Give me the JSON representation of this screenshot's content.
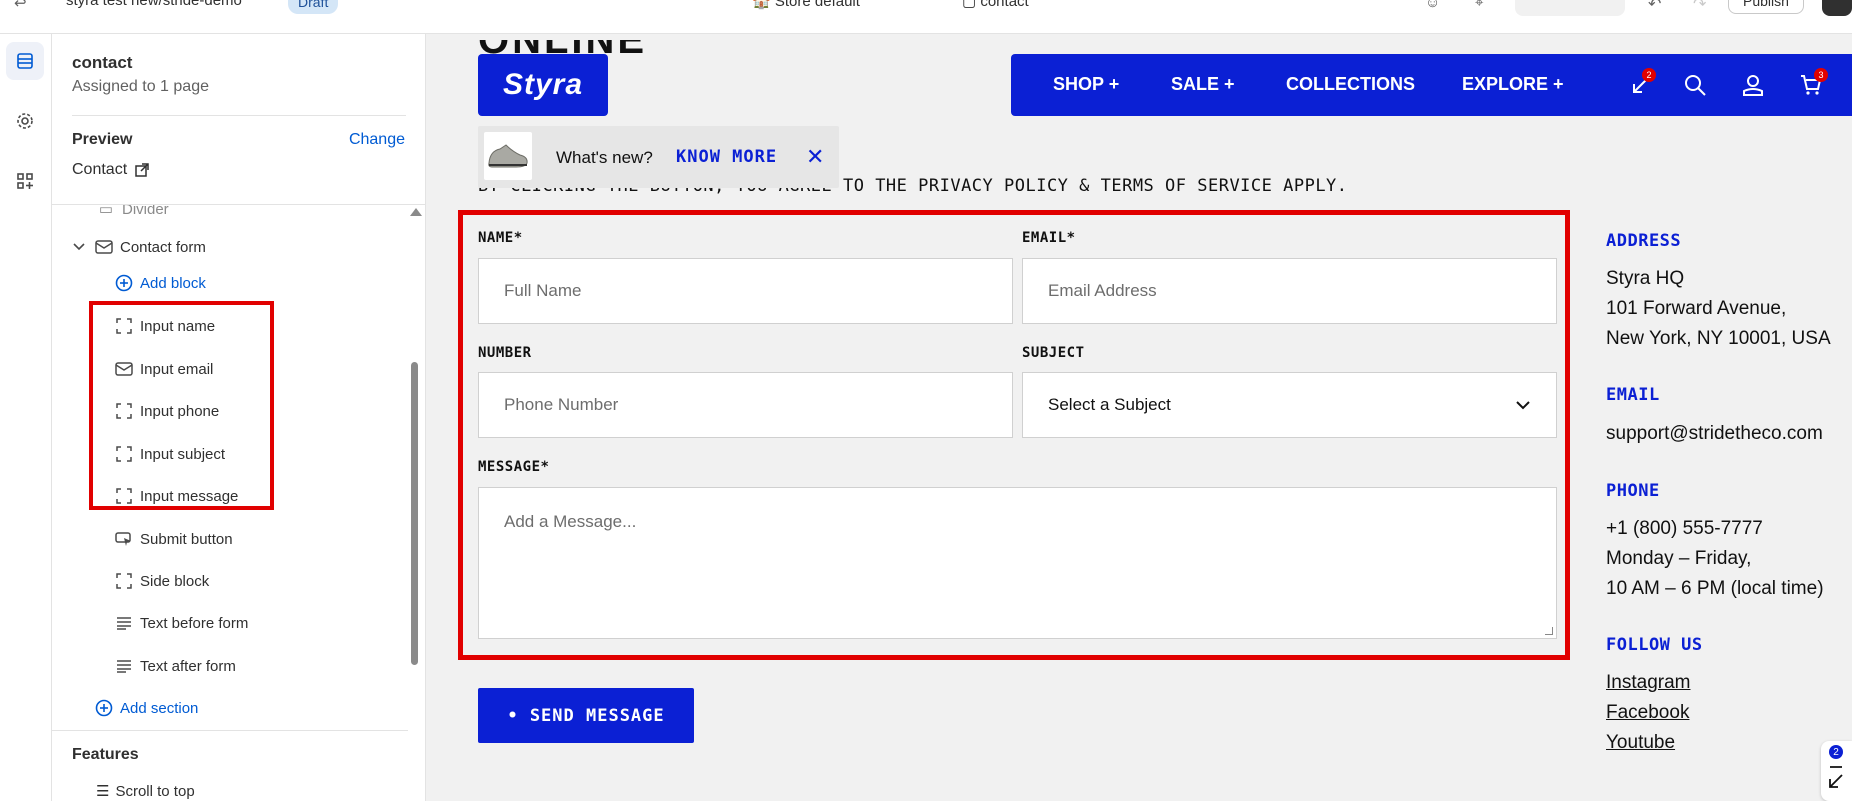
{
  "topbar": {
    "breadcrumb": "styra test new/stride-demo",
    "status": "Draft",
    "store": "Store default",
    "template": "contact",
    "publish": "Publish"
  },
  "panel": {
    "template_title": "contact",
    "template_sub": "Assigned to 1 page",
    "preview_label": "Preview",
    "change_label": "Change",
    "preview_page": "Contact",
    "divider_partial": "Divider",
    "section": "Contact form",
    "add_block": "Add block",
    "blocks": [
      "Input name",
      "Input email",
      "Input phone",
      "Input subject",
      "Input message",
      "Submit button",
      "Side block",
      "Text before form",
      "Text after form"
    ],
    "add_section": "Add section",
    "features_label": "Features",
    "scroll_to_top": "Scroll to top"
  },
  "site": {
    "logo": "Styra",
    "nav": [
      "SHOP +",
      "SALE +",
      "COLLECTIONS",
      "EXPLORE +"
    ],
    "compare_count": "2",
    "cart_count": "3",
    "page_title_partial": "ONLINE",
    "popup": {
      "whats_new": "What's new?",
      "know_more": "KNOW MORE"
    },
    "disclaimer": "BY CLICKING THE BUTTON, YOU AGREE TO THE PRIVACY POLICY & TERMS OF SERVICE APPLY.",
    "form": {
      "name_label": "NAME*",
      "name_placeholder": "Full Name",
      "email_label": "EMAIL*",
      "email_placeholder": "Email Address",
      "number_label": "NUMBER",
      "number_placeholder": "Phone Number",
      "subject_label": "SUBJECT",
      "subject_value": "Select a Subject",
      "message_label": "MESSAGE*",
      "message_placeholder": "Add a Message...",
      "send": "• SEND MESSAGE"
    },
    "side": {
      "address_h": "ADDRESS",
      "address_1": "Styra HQ",
      "address_2": "101 Forward Avenue,",
      "address_3": "New York, NY 10001, USA",
      "email_h": "EMAIL",
      "email": "support@stridetheco.com",
      "phone_h": "PHONE",
      "phone": "+1 (800) 555-7777",
      "hours_1": "Monday – Friday,",
      "hours_2": "10 AM – 6 PM (local time)",
      "follow_h": "FOLLOW US",
      "links": [
        "Instagram",
        "Facebook",
        "Youtube"
      ]
    },
    "floater_count": "2"
  },
  "colors": {
    "brand": "#0b20d4",
    "highlight": "#e10000",
    "link": "#005bd3"
  }
}
